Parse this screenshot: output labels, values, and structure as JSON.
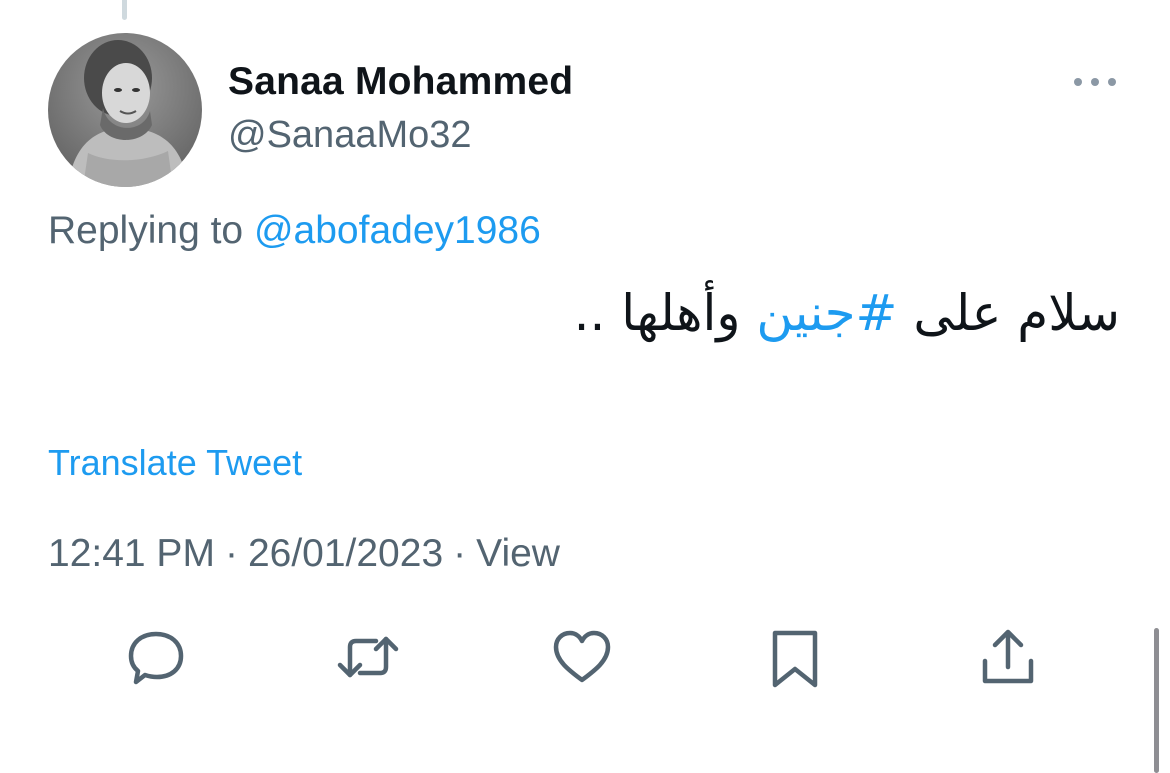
{
  "tweet": {
    "author": {
      "display_name": "Sanaa Mohammed",
      "handle": "@SanaaMo32"
    },
    "reply": {
      "prefix": "Replying to ",
      "mention": "@abofadey1986"
    },
    "text": {
      "before": "سلام على ",
      "hashtag": "#جنين",
      "after": " وأهلها .."
    },
    "translate_label": "Translate Tweet",
    "meta": {
      "time": "12:41 PM",
      "separator": "·",
      "date": "26/01/2023",
      "views": "View"
    }
  },
  "icons": {
    "more": "more-horizontal-icon",
    "reply": "reply-icon",
    "retweet": "retweet-icon",
    "like": "heart-icon",
    "bookmark": "bookmark-icon",
    "share": "share-icon"
  },
  "colors": {
    "link": "#1d9bf0",
    "secondary_text": "#536471",
    "primary_text": "#0f1419",
    "icon": "#536471"
  }
}
